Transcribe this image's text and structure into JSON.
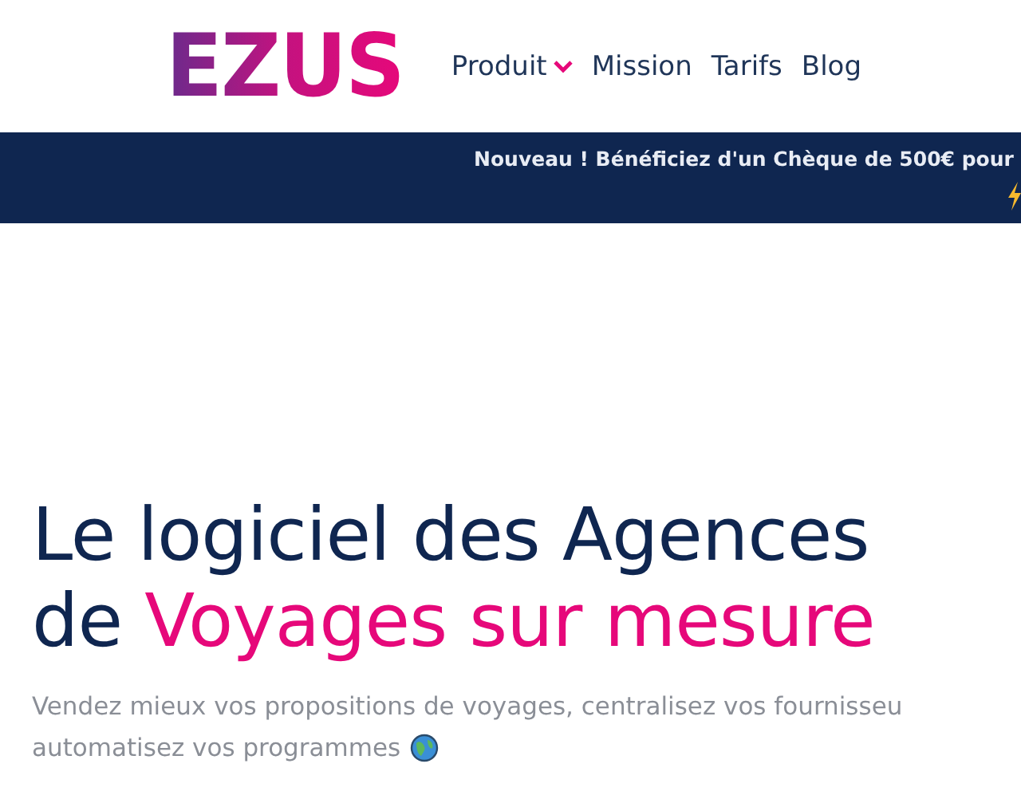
{
  "logo": "EZUS",
  "nav": [
    {
      "label": "Produit",
      "dropdown": true
    },
    {
      "label": "Mission",
      "dropdown": false
    },
    {
      "label": "Tarifs",
      "dropdown": false
    },
    {
      "label": "Blog",
      "dropdown": false
    }
  ],
  "banner": {
    "text": "Nouveau ! Bénéficiez d'un Chèque de 500€ pour"
  },
  "headline": {
    "line1": "Le logiciel des Agences",
    "line2_plain": "de ",
    "line2_highlight": "Voyages sur mesure"
  },
  "subtitle": {
    "line1": "Vendez mieux vos propositions de voyages, centralisez vos fournisseu",
    "line2": "automatisez vos programmes"
  }
}
